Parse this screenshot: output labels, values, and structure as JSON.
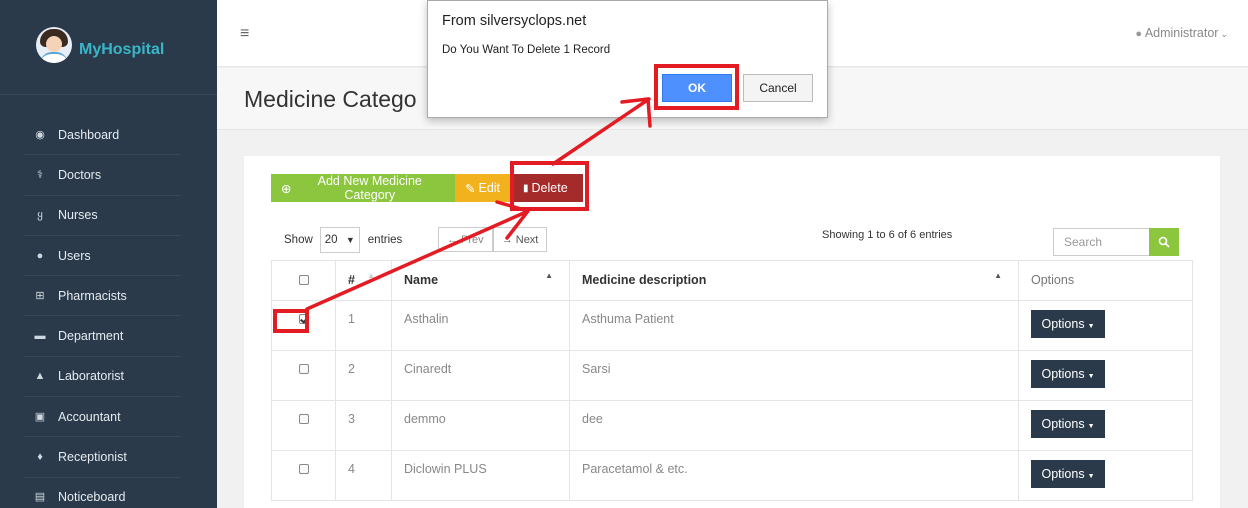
{
  "app": {
    "name": "MyHospital"
  },
  "sidebar": {
    "items": [
      {
        "label": "Dashboard",
        "icon": "dashboard-icon",
        "glyph": "◉"
      },
      {
        "label": "Doctors",
        "icon": "doctor-icon",
        "glyph": "⚕"
      },
      {
        "label": "Nurses",
        "icon": "stethoscope-icon",
        "glyph": "ყ"
      },
      {
        "label": "Users",
        "icon": "user-icon",
        "glyph": "●"
      },
      {
        "label": "Pharmacists",
        "icon": "plus-square-icon",
        "glyph": "⊞"
      },
      {
        "label": "Department",
        "icon": "briefcase-icon",
        "glyph": "▬"
      },
      {
        "label": "Laboratorist",
        "icon": "flask-icon",
        "glyph": "▲"
      },
      {
        "label": "Accountant",
        "icon": "money-icon",
        "glyph": "▣"
      },
      {
        "label": "Receptionist",
        "icon": "receptionist-icon",
        "glyph": "♦"
      },
      {
        "label": "Noticeboard",
        "icon": "file-icon",
        "glyph": "▤"
      }
    ]
  },
  "header": {
    "menu_glyph": "≡",
    "user_label": "Administrator",
    "user_glyph": "👤",
    "chevron": "⌄"
  },
  "page": {
    "title": "Medicine Catego"
  },
  "toolbar": {
    "add_label": "Add New Medicine Category",
    "add_glyph": "⊕",
    "edit_label": "Edit",
    "edit_glyph": "✎",
    "delete_label": "Delete",
    "delete_glyph": "🗑"
  },
  "table_controls": {
    "show_label": "Show",
    "page_size": "20",
    "entries_label": "entries",
    "prev_label": "← Prev",
    "next_label": "→ Next",
    "showing_text": "Showing 1 to 6 of 6 entries",
    "search_placeholder": "Search"
  },
  "table": {
    "headers": {
      "num": "#",
      "name": "Name",
      "desc": "Medicine description",
      "options": "Options"
    },
    "rows": [
      {
        "num": "1",
        "name": "Asthalin",
        "desc": "Asthuma Patient",
        "checked": true
      },
      {
        "num": "2",
        "name": "Cinaredt",
        "desc": "Sarsi",
        "checked": false
      },
      {
        "num": "3",
        "name": "demmo",
        "desc": "dee",
        "checked": false
      },
      {
        "num": "4",
        "name": "Diclowin PLUS",
        "desc": "Paracetamol & etc.",
        "checked": false
      }
    ],
    "options_label": "Options"
  },
  "dialog": {
    "title": "From silversyclops.net",
    "message": "Do You Want To Delete 1 Record",
    "ok_label": "OK",
    "cancel_label": "Cancel"
  },
  "colors": {
    "sidebar": "#2b3a4a",
    "green": "#8cc63f",
    "amber": "#f2b21e",
    "red": "#a52a2a",
    "annotation": "#e31b23",
    "ok_blue": "#4d90fe"
  }
}
